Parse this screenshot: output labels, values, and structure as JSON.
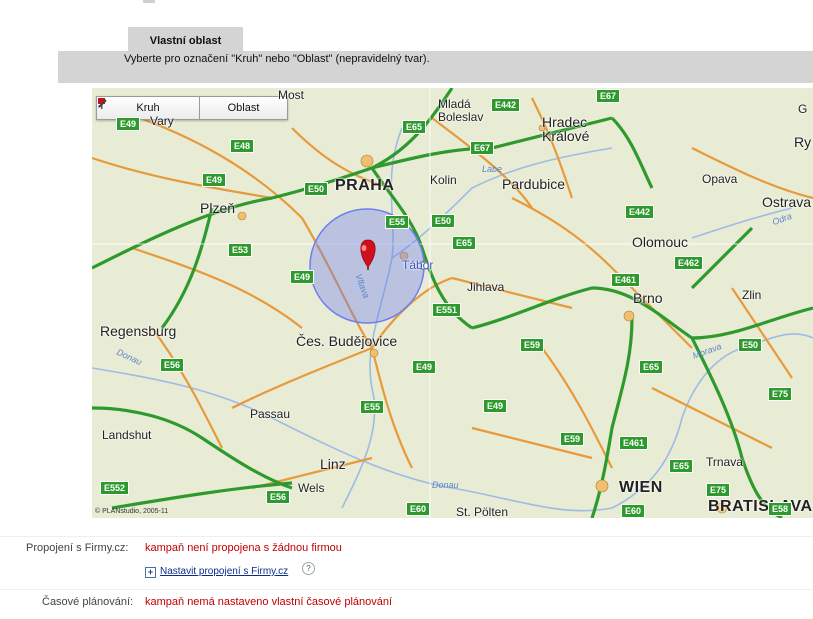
{
  "tab": {
    "title": "Vlastní oblast"
  },
  "instruction": "Vyberte pro označení \"Kruh\" nebo \"Oblast\" (nepravidelný tvar).",
  "map_tools": {
    "circle_label": "Kruh",
    "area_label": "Oblast"
  },
  "map_labels": {
    "praha": "PRAHA",
    "plzen": "Plzeň",
    "ceske_budejovice": "Čes. Budějovice",
    "regensburg": "Regensburg",
    "passau": "Passau",
    "landshut": "Landshut",
    "linz": "Linz",
    "wels": "Wels",
    "st_polten": "St. Pölten",
    "wien": "WIEN",
    "bratislava": "BRATISLAVA",
    "trnava": "Trnava",
    "zlin": "Zlin",
    "brno": "Brno",
    "jihlava": "Jihlava",
    "tabor": "Tábor",
    "kolin": "Kolin",
    "pardubice": "Pardubice",
    "hradec": "Hradec",
    "kralove": "Králové",
    "mlada": "Mladá",
    "boleslav": "Boleslav",
    "most": "Most",
    "vary": "Vary",
    "olomouc": "Olomouc",
    "opava": "Opava",
    "ostrava": "Ostrava",
    "ry": "Ry",
    "g": "G"
  },
  "river_labels": {
    "vltava": "Vltava",
    "labe": "Labe",
    "donau1": "Donau",
    "donau2": "Donau",
    "morava": "Morava",
    "odra": "Odra"
  },
  "road_shields": {
    "e49a": "E49",
    "e48": "E48",
    "e49b": "E49",
    "e50a": "E50",
    "e53": "E53",
    "e49c": "E49",
    "e65a": "E65",
    "e55a": "E55",
    "e50b": "E50",
    "e65b": "E65",
    "e442a": "E442",
    "e67a": "E67",
    "e67b": "E67",
    "e442b": "E442",
    "e461a": "E461",
    "e462": "E462",
    "e551": "E551",
    "e59": "E59",
    "e56": "E56",
    "e55b": "E55",
    "e49d": "E49",
    "e49e": "E49",
    "e59b": "E59",
    "e461b": "E461",
    "e65c": "E65",
    "e65d": "E65",
    "e50c": "E50",
    "e75a": "E75",
    "e75b": "E75",
    "e552": "E552",
    "e56b": "E56",
    "e60a": "E60",
    "e60b": "E60",
    "e58": "E58"
  },
  "copyright": "© PLANstudio, 2005-11",
  "fields": {
    "firmy_label": "Propojení s Firmy.cz:",
    "firmy_value": "kampaň není propojena s žádnou firmou",
    "firmy_link": "Nastavit propojení s Firmy.cz",
    "help": "?",
    "plus": "+",
    "schedule_label": "Časové plánování:",
    "schedule_value": "kampaň nemá nastaveno vlastní časové plánování"
  },
  "colors": {
    "highway": "#2e9a2e",
    "road": "#e69a3a",
    "circle": "#6e7ff0",
    "pin": "#d0101a",
    "error_text": "#c00000"
  }
}
